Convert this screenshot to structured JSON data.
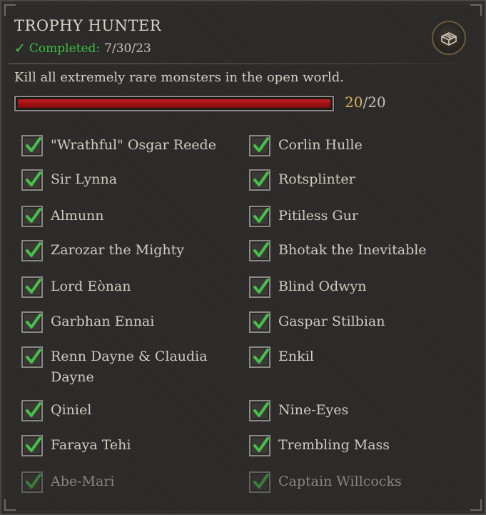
{
  "achievement": {
    "title": "TROPHY HUNTER",
    "completed_label": "Completed:",
    "completed_date": "7/30/23",
    "description": "Kill all extremely rare monsters in the open world.",
    "progress_current": "20",
    "progress_total": "/20",
    "progress_fraction": 1.0,
    "icon": "trophy-chest-icon"
  },
  "colors": {
    "accent_green": "#3fbf3f",
    "progress_red": "#b0161b",
    "count_gold": "#d6b45c"
  },
  "monsters": [
    {
      "name": "\"Wrathful\" Osgar Reede",
      "checked": true
    },
    {
      "name": "Corlin Hulle",
      "checked": true
    },
    {
      "name": "Sir Lynna",
      "checked": true
    },
    {
      "name": "Rotsplinter",
      "checked": true
    },
    {
      "name": "Almunn",
      "checked": true
    },
    {
      "name": "Pitiless Gur",
      "checked": true
    },
    {
      "name": "Zarozar the Mighty",
      "checked": true
    },
    {
      "name": "Bhotak the Inevitable",
      "checked": true
    },
    {
      "name": "Lord Eònan",
      "checked": true
    },
    {
      "name": "Blind Odwyn",
      "checked": true
    },
    {
      "name": "Garbhan Ennai",
      "checked": true
    },
    {
      "name": "Gaspar Stilbian",
      "checked": true
    },
    {
      "name": "Renn Dayne & Claudia Dayne",
      "checked": true
    },
    {
      "name": "Enkil",
      "checked": true
    },
    {
      "name": "Qiniel",
      "checked": true
    },
    {
      "name": "Nine-Eyes",
      "checked": true
    },
    {
      "name": "Faraya Tehi",
      "checked": true
    },
    {
      "name": "Trembling Mass",
      "checked": true
    },
    {
      "name": "Abe-Mari",
      "checked": true
    },
    {
      "name": "Captain Willcocks",
      "checked": true
    }
  ]
}
